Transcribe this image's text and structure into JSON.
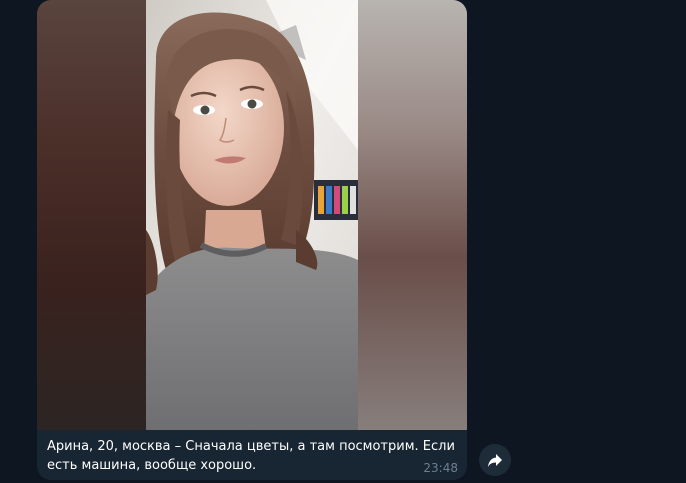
{
  "message": {
    "caption": "Арина, 20, москва – Сначала цветы, а там посмотрим. Если есть машина, вообще хорошо.",
    "time": "23:48"
  },
  "icons": {
    "share": "share-arrow-icon"
  },
  "colors": {
    "background": "#0e1621",
    "bubble": "#182533",
    "time_text": "#6d7f8f",
    "share_button": "#1e2c3a"
  }
}
